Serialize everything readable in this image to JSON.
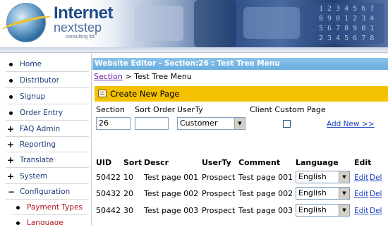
{
  "brand": {
    "name": "Internet",
    "sub": "nextstep",
    "tagline": "consulting ltd"
  },
  "sidebar": {
    "items": [
      {
        "label": "Home",
        "marker": "bullet"
      },
      {
        "label": "Distributor",
        "marker": "bullet"
      },
      {
        "label": "Signup",
        "marker": "bullet"
      },
      {
        "label": "Order Entry",
        "marker": "bullet"
      },
      {
        "label": "FAQ Admin",
        "marker": "plus"
      },
      {
        "label": "Reporting",
        "marker": "plus"
      },
      {
        "label": "Translate",
        "marker": "plus"
      },
      {
        "label": "System",
        "marker": "plus"
      },
      {
        "label": "Configuration",
        "marker": "minus"
      },
      {
        "label": "Payment Types",
        "marker": "bullet",
        "active": true
      },
      {
        "label": "Language",
        "marker": "bullet",
        "active": true
      }
    ]
  },
  "main": {
    "title": "Website Editor - Section:26 : Test Tree Menu",
    "breadcrumb": {
      "link": "Section",
      "separator": " > ",
      "current": "Test Tree Menu"
    },
    "create_label": "Create New Page",
    "form": {
      "section_label": "Section",
      "sort_label": "Sort Order",
      "userty_label": "UserTy",
      "client_label": "Client Custom Page",
      "section_value": "26",
      "sort_value": "",
      "userty_value": "Customer",
      "client_checked": false,
      "add_new": "Add New >>"
    },
    "table": {
      "headers": [
        "UID",
        "Sort",
        "Descr",
        "UserTy",
        "Comment",
        "Language",
        "Edit"
      ],
      "rows": [
        {
          "uid": "50422",
          "sort": "10",
          "descr": "Test page 001",
          "userty": "Prospect",
          "comment": "Test page 001",
          "language": "English",
          "edit": "Edit",
          "del": "Del"
        },
        {
          "uid": "50432",
          "sort": "20",
          "descr": "Test page 002",
          "userty": "Prospect",
          "comment": "Test page 002",
          "language": "English",
          "edit": "Edit",
          "del": "Del"
        },
        {
          "uid": "50442",
          "sort": "30",
          "descr": "Test page 003",
          "userty": "Prospect",
          "comment": "Test page 003",
          "language": "English",
          "edit": "Edit",
          "del": "Del"
        }
      ]
    }
  },
  "colors": {
    "title_bar": "#6aaede",
    "create_bar": "#f4c200",
    "nav_text": "#1d3d7a",
    "active_nav": "#b0141a",
    "link": "#1a3dbf"
  }
}
